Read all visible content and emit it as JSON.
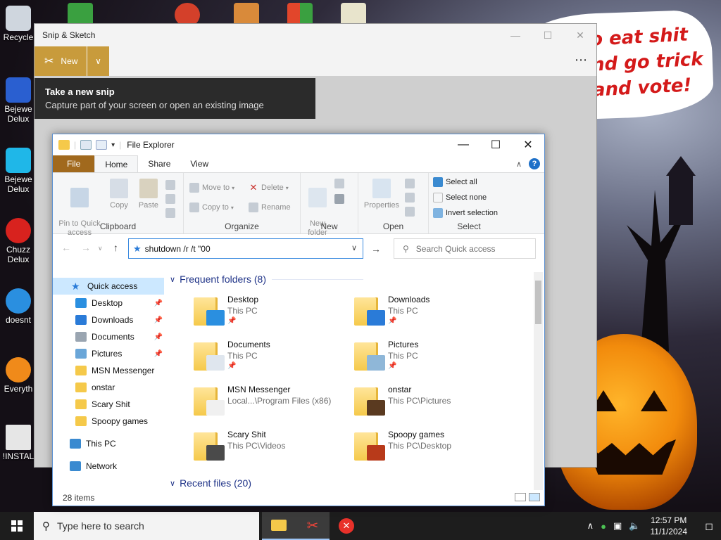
{
  "desktop": {
    "overlay_text": [
      "o eat shit",
      "nd go trick",
      "and vote!"
    ],
    "icons": [
      {
        "label": "Recycle",
        "icon": "recycle-bin-icon",
        "color": "#cfd6de"
      },
      {
        "label": "Bejewe\nDelux",
        "icon": "bejeweled-icon",
        "color": "#2a5fd0"
      },
      {
        "label": "Bejewe\nDelux",
        "icon": "gem-icon",
        "color": "#1fb7e8"
      },
      {
        "label": "Chuzz\nDelux",
        "icon": "chuzzle-icon",
        "color": "#d8221e"
      },
      {
        "label": "doesnt",
        "icon": "app-icon",
        "color": "#2a8fe0"
      },
      {
        "label": "Everyth",
        "icon": "search-magnifier-icon",
        "color": "#f08a1a"
      },
      {
        "label": "!INSTAL",
        "icon": "document-icon",
        "color": "#e6e6e6"
      }
    ]
  },
  "snip": {
    "title": "Snip & Sketch",
    "new_label": "New",
    "tooltip_title": "Take a new snip",
    "tooltip_desc": "Capture part of your screen or open an existing image"
  },
  "explorer": {
    "title": "File Explorer",
    "tabs": [
      "File",
      "Home",
      "Share",
      "View"
    ],
    "ribbon": {
      "clipboard": {
        "label": "Clipboard",
        "pin": "Pin to Quick\naccess",
        "copy": "Copy",
        "paste": "Paste"
      },
      "organize": {
        "label": "Organize",
        "move_to": "Move to",
        "copy_to": "Copy to",
        "delete": "Delete",
        "rename": "Rename"
      },
      "new": {
        "label": "New",
        "new_folder": "New\nfolder"
      },
      "open": {
        "label": "Open",
        "properties": "Properties"
      },
      "select": {
        "label": "Select",
        "select_all": "Select all",
        "select_none": "Select none",
        "invert": "Invert selection"
      }
    },
    "address": "shutdown /r /t \"00",
    "search_placeholder": "Search Quick access",
    "nav": [
      {
        "label": "Quick access",
        "icon": "star-icon",
        "color": "#2a7bd8",
        "pinned": false,
        "indent": 0
      },
      {
        "label": "Desktop",
        "icon": "desktop-icon",
        "color": "#2a8fe0",
        "pinned": true,
        "indent": 1
      },
      {
        "label": "Downloads",
        "icon": "download-icon",
        "color": "#2a7bd8",
        "pinned": true,
        "indent": 1
      },
      {
        "label": "Documents",
        "icon": "documents-icon",
        "color": "#9aa5b1",
        "pinned": true,
        "indent": 1
      },
      {
        "label": "Pictures",
        "icon": "pictures-icon",
        "color": "#6aa6d8",
        "pinned": true,
        "indent": 1
      },
      {
        "label": "MSN Messenger",
        "icon": "folder-icon",
        "color": "#f5c94a",
        "pinned": false,
        "indent": 1
      },
      {
        "label": "onstar",
        "icon": "folder-icon",
        "color": "#f5c94a",
        "pinned": false,
        "indent": 1
      },
      {
        "label": "Scary Shit",
        "icon": "folder-icon",
        "color": "#f5c94a",
        "pinned": false,
        "indent": 1
      },
      {
        "label": "Spoopy games",
        "icon": "folder-icon",
        "color": "#f5c94a",
        "pinned": false,
        "indent": 1
      },
      {
        "label": "This PC",
        "icon": "computer-icon",
        "color": "#3a8ad0",
        "pinned": false,
        "indent": 0
      },
      {
        "label": "Network",
        "icon": "network-icon",
        "color": "#3a8ad0",
        "pinned": false,
        "indent": 0
      }
    ],
    "frequent_header": "Frequent folders (8)",
    "recent_header": "Recent files (20)",
    "folders": [
      {
        "name": "Desktop",
        "location": "This PC",
        "pinned": true,
        "overlay": "#2a8fe0"
      },
      {
        "name": "Downloads",
        "location": "This PC",
        "pinned": true,
        "overlay": "#2a7bd8"
      },
      {
        "name": "Documents",
        "location": "This PC",
        "pinned": true,
        "overlay": "#dfe6ee"
      },
      {
        "name": "Pictures",
        "location": "This PC",
        "pinned": true,
        "overlay": "#8fb7d8"
      },
      {
        "name": "MSN Messenger",
        "location": "Local...\\Program Files (x86)",
        "pinned": false,
        "overlay": "#f0f0f0"
      },
      {
        "name": "onstar",
        "location": "This PC\\Pictures",
        "pinned": false,
        "overlay": "#5a3a20"
      },
      {
        "name": "Scary Shit",
        "location": "This PC\\Videos",
        "pinned": false,
        "overlay": "#4a4a4a"
      },
      {
        "name": "Spoopy games",
        "location": "This PC\\Desktop",
        "pinned": false,
        "overlay": "#b83a1a"
      }
    ],
    "status": "28 items"
  },
  "taskbar": {
    "search_placeholder": "Type here to search",
    "time": "12:57 PM",
    "date": "11/1/2024"
  }
}
